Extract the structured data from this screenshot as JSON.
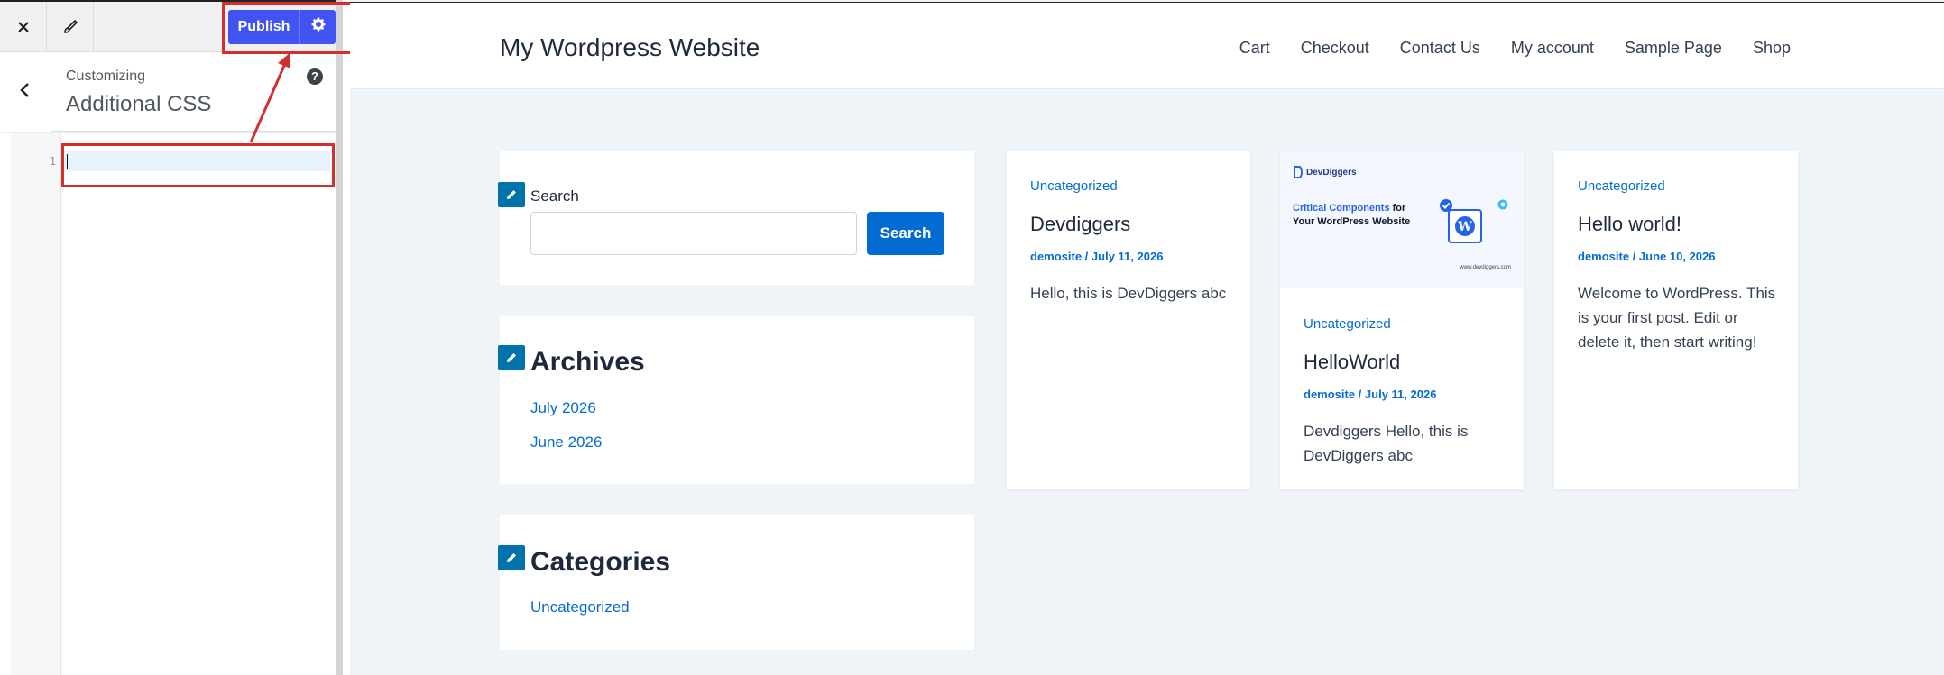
{
  "toolbar": {
    "publish_label": "Publish"
  },
  "section": {
    "small_label": "Customizing",
    "title": "Additional CSS",
    "help_glyph": "?"
  },
  "editor": {
    "line_number": "1",
    "content": ""
  },
  "site": {
    "title": "My Wordpress Website",
    "nav": [
      "Cart",
      "Checkout",
      "Contact Us",
      "My account",
      "Sample Page",
      "Shop"
    ]
  },
  "widgets": {
    "search": {
      "title": "Search",
      "placeholder": "",
      "button_label": "Search"
    },
    "archives": {
      "title": "Archives",
      "links": [
        "July 2026",
        "June 2026"
      ]
    },
    "categories": {
      "title": "Categories",
      "links": [
        "Uncategorized"
      ]
    }
  },
  "posts": [
    {
      "category": "Uncategorized",
      "title": "Devdiggers",
      "meta": "demosite / July 11, 2026",
      "excerpt": "Hello, this is DevDiggers abc"
    },
    {
      "category": "Uncategorized",
      "title": "HelloWorld",
      "meta": "demosite / July 11, 2026",
      "excerpt": "Devdiggers Hello, this is DevDiggers abc",
      "thumbnail": {
        "brand": "DevDiggers",
        "headline_accent": "Critical Components",
        "headline_rest": "for Your WordPress Website",
        "url": "www.devdiggers.com"
      }
    },
    {
      "category": "Uncategorized",
      "title": "Hello world!",
      "meta": "demosite / June 10, 2026",
      "excerpt": "Welcome to WordPress. This is your first post. Edit or delete it, then start writing!"
    }
  ],
  "colors": {
    "publish": "#4154f1",
    "link": "#046bd2",
    "annotation": "#d32f2f",
    "edit_shortcut": "#0073aa"
  }
}
